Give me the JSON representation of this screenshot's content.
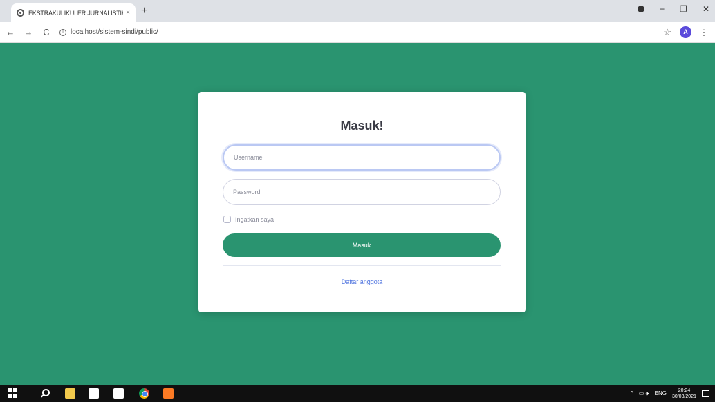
{
  "browser": {
    "tab_title": "EKSTRAKULIKULER JURNALISTIK",
    "tab_close": "×",
    "new_tab": "+",
    "url": "localhost/sistem-sindi/public/",
    "avatar_letter": "A",
    "back": "←",
    "forward": "→",
    "reload": "C",
    "star": "☆",
    "menu": "⋮",
    "minimize": "−",
    "restore": "❐",
    "close": "✕"
  },
  "login": {
    "title": "Masuk!",
    "username_placeholder": "Username",
    "password_placeholder": "Password",
    "remember_label": "Ingatkan saya",
    "submit_label": "Masuk",
    "register_link": "Daftar anggota"
  },
  "taskbar": {
    "language": "ENG",
    "time": "20:24",
    "date": "30/03/2021",
    "tray_up": "^",
    "tray_icons": "▭ 🕪"
  },
  "colors": {
    "page_background": "#2a9470",
    "button": "#2a9470",
    "link": "#4e73df"
  }
}
